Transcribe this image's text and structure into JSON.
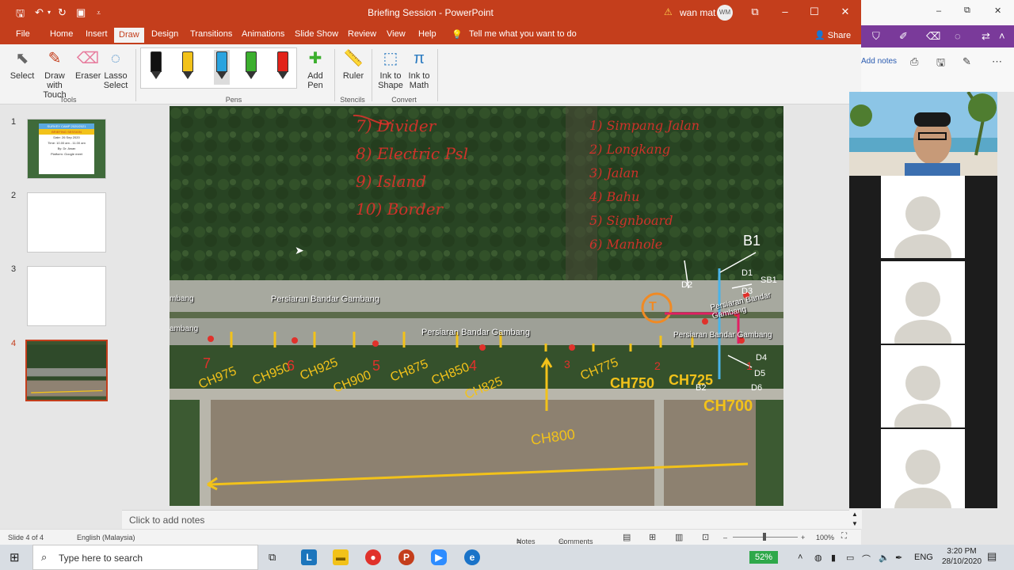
{
  "window": {
    "title": "Briefing Session  -  PowerPoint",
    "user_name": "wan mat",
    "user_initials": "WM"
  },
  "quick_access": {
    "save": "save-icon",
    "undo": "undo-icon",
    "redo": "redo-icon",
    "present": "present-icon"
  },
  "tabs": [
    "File",
    "Home",
    "Insert",
    "Draw",
    "Design",
    "Transitions",
    "Animations",
    "Slide Show",
    "Review",
    "View",
    "Help"
  ],
  "active_tab": "Draw",
  "tell_me": "Tell me what you want to do",
  "share": "Share",
  "ribbon": {
    "tools": {
      "select": "Select",
      "draw_touch": "Draw with Touch",
      "eraser": "Eraser",
      "lasso": "Lasso Select",
      "label": "Tools"
    },
    "pens_label": "Pens",
    "add_pen": "Add Pen",
    "stencils": {
      "ruler": "Ruler",
      "label": "Stencils"
    },
    "convert": {
      "ink_shape": "Ink to Shape",
      "ink_math": "Ink to Math",
      "label": "Convert"
    },
    "pen_colors": [
      "#111111",
      "#f2c21a",
      "#2aa3df",
      "#3caf2e",
      "#e2231a"
    ]
  },
  "slides": {
    "numbers": [
      "1",
      "2",
      "3",
      "4"
    ],
    "active": "4",
    "thumb1": {
      "line1": "SURVEY CAMP 2020/2021",
      "line2": "BRIEFING SESSION",
      "line3": "Date: 26 Sep 2020",
      "line4": "Time: 10.00 am - 11.00 am",
      "line5": "By: Dr. Awan",
      "line6": "Platform: Google meet"
    }
  },
  "slide": {
    "road_top": "Persiaran Bandar Gambang",
    "road_bottom": "Persiaran Bandar Gambang",
    "road_right_top": "Persiaran Bandar Gambang",
    "road_right_bottom": "Persiaran Bandar Gambang",
    "road_left_top": "mbang",
    "road_left_bottom": "ambang",
    "red_list_left": [
      "7) Divider",
      "8) Electric Psl",
      "9) Island",
      "10) Border"
    ],
    "red_list_right": [
      "1) Simpang Jalan",
      "2) Longkang",
      "3) Jalan",
      "4) Bahu",
      "5) Signboard",
      "6) Manhole"
    ],
    "chainages": [
      "CH975",
      "CH950",
      "CH925",
      "CH900",
      "CH875",
      "CH850",
      "CH825",
      "CH775",
      "CH750",
      "CH725",
      "CH700",
      "CH800"
    ],
    "numbers": [
      "7",
      "6",
      "5",
      "4",
      "3",
      "2",
      "1"
    ],
    "labels": [
      "B1",
      "B2",
      "D1",
      "D2",
      "D3",
      "D4",
      "D5",
      "D6",
      "SB1"
    ]
  },
  "notes_placeholder": "Click to add notes",
  "status": {
    "slide": "Slide 4 of 4",
    "language": "English (Malaysia)",
    "notes": "Notes",
    "comments": "Comments",
    "zoom": "100%"
  },
  "right_panel": {
    "add_notes": "Add notes"
  },
  "taskbar": {
    "search_placeholder": "Type here to search",
    "battery": "52%",
    "lang": "ENG",
    "time": "3:20 PM",
    "date": "28/10/2020"
  }
}
